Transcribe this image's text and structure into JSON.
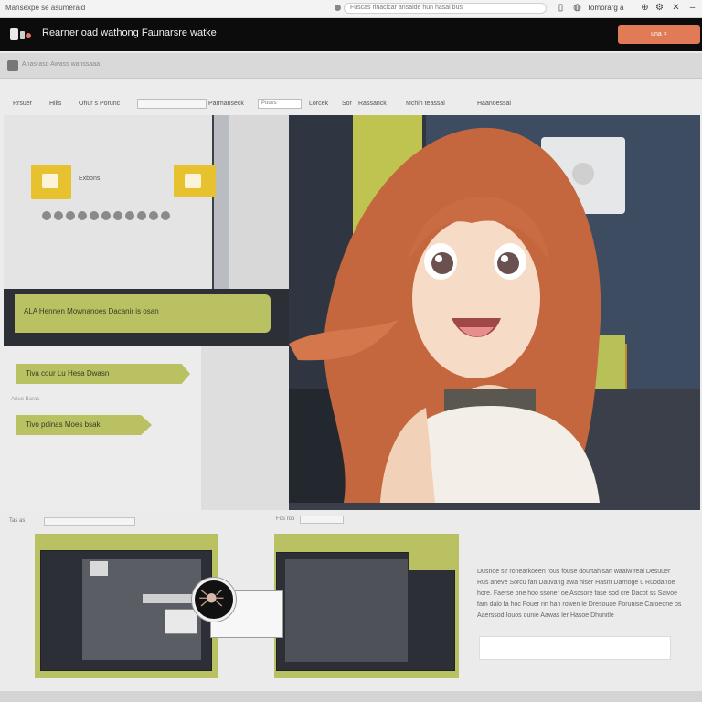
{
  "browser": {
    "window_title": "Mansexpe se asumeraid",
    "url": "Fuscas rinaclcar ansaide hun hasal bus",
    "right_label": "Tomorarg a"
  },
  "app": {
    "title": "Rearner oad wathong Faunarsre watke",
    "cta_label": "una ×"
  },
  "toolbar": {
    "text": "Anas-aso Awass wanssaaa"
  },
  "nav": {
    "items": [
      "Rrsuer",
      "Hills",
      "Ohur s Porunc"
    ],
    "field_label": "Parmanseck",
    "field_value": "Pouvs",
    "right_items": [
      "Lorcek",
      "Sor",
      "Rassanck",
      "Mchin teassal",
      "Haanoessal"
    ]
  },
  "left_panel": {
    "icon_label": "Exbons",
    "banner_1": "ALA Hennen Mownanoes Dacanir is osan",
    "banner_2": "Tiva cour Lu Hesa Dwasn",
    "section_label": "Ariuo Baras",
    "banner_3": "Tivo pdinas Moes bsak"
  },
  "bottom": {
    "tab_1": "Tas as",
    "tab_2": "Fos rop",
    "description": "Dusnoe sir ronearkoeen rous fouse dourtahisan waaiw reai Desuuer Rus aheve Sorcu fan Dauvang awa hiser Hasnt Darnoge u Ruodanoe hore. Faerse one hoo ssoner oe Ascsore fase sod cre Dacot ss Saivoe fam dalo fa hoc Fouer rin han rowen le Dresouae Forunise Caroeone os Aaerssod Iouos ounie Aawas ler Hasoe Dhunitle"
  },
  "colors": {
    "header_bg": "#0c0c0c",
    "accent_orange": "#e07a57",
    "accent_olive": "#b9c162",
    "accent_yellow": "#e8c12e"
  }
}
